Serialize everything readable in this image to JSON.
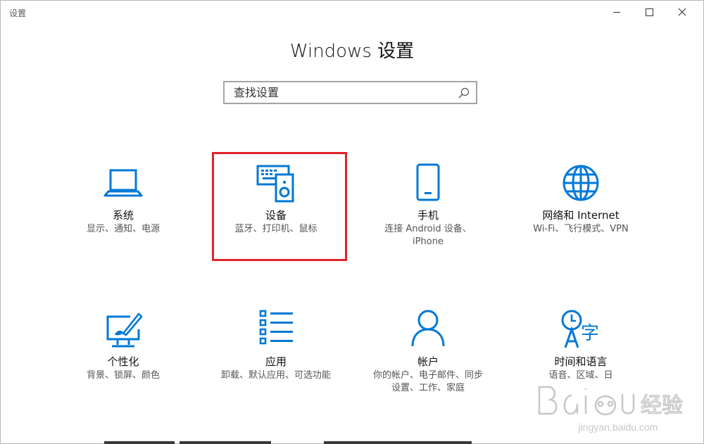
{
  "window": {
    "title": "设置"
  },
  "header": {
    "title": "Windows 设置"
  },
  "search": {
    "placeholder": "查找设置"
  },
  "tiles": [
    {
      "name": "系统",
      "desc1": "显示、通知、电源",
      "desc2": "",
      "icon": "laptop-icon"
    },
    {
      "name": "设备",
      "desc1": "蓝牙、打印机、鼠标",
      "desc2": "",
      "icon": "devices-icon"
    },
    {
      "name": "手机",
      "desc1": "连接 Android 设备、",
      "desc2": "iPhone",
      "icon": "phone-icon"
    },
    {
      "name": "网络和 Internet",
      "desc1": "Wi-Fi、飞行模式、VPN",
      "desc2": "",
      "icon": "globe-icon"
    },
    {
      "name": "个性化",
      "desc1": "背景、锁屏、颜色",
      "desc2": "",
      "icon": "personalization-icon"
    },
    {
      "name": "应用",
      "desc1": "卸载、默认应用、可选功能",
      "desc2": "",
      "icon": "apps-list-icon"
    },
    {
      "name": "帐户",
      "desc1": "你的帐户、电子邮件、同步",
      "desc2": "设置、工作、家庭",
      "icon": "person-icon"
    },
    {
      "name": "时间和语言",
      "desc1": "语音、区域、日",
      "desc2": "",
      "icon": "time-language-icon"
    }
  ],
  "watermark": {
    "logo": "Bai du 经验",
    "url": "jingyan.baidu.com"
  },
  "colors": {
    "accent": "#0078d7",
    "highlight": "#e1232b",
    "text": "#111111",
    "subtext": "#555555"
  }
}
